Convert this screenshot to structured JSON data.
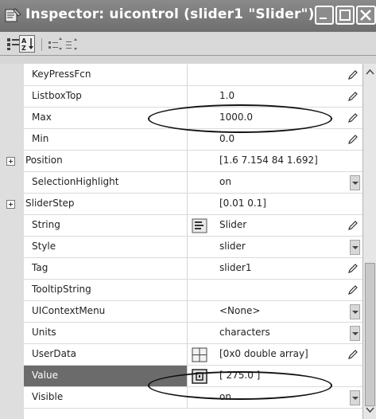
{
  "window": {
    "title": "Inspector:  uicontrol (slider1 \"Slider\")",
    "icon": "inspector-icon"
  },
  "toolbar": {
    "buttons": [
      "categorized-view-icon",
      "alphabetical-sort-icon",
      "expand-all-icon",
      "collapse-all-icon"
    ]
  },
  "properties": [
    {
      "name": "KeyPressFcn",
      "value": "",
      "editor": "pencil"
    },
    {
      "name": "ListboxTop",
      "value": "1.0",
      "editor": "pencil"
    },
    {
      "name": "Max",
      "value": "1000.0",
      "editor": "pencil"
    },
    {
      "name": "Min",
      "value": "0.0",
      "editor": "pencil"
    },
    {
      "name": "Position",
      "value": "[1.6 7.154 84 1.692]",
      "editor": "none",
      "expandable": true
    },
    {
      "name": "SelectionHighlight",
      "value": "on",
      "editor": "dropdown"
    },
    {
      "name": "SliderStep",
      "value": "[0.01 0.1]",
      "editor": "none",
      "expandable": true
    },
    {
      "name": "String",
      "value": "Slider",
      "editor": "pencil",
      "cell_icon": "text-editor-icon"
    },
    {
      "name": "Style",
      "value": "slider",
      "editor": "dropdown"
    },
    {
      "name": "Tag",
      "value": "slider1",
      "editor": "pencil"
    },
    {
      "name": "TooltipString",
      "value": "",
      "editor": "pencil"
    },
    {
      "name": "UIContextMenu",
      "value": "<None>",
      "editor": "dropdown"
    },
    {
      "name": "Units",
      "value": "characters",
      "editor": "dropdown"
    },
    {
      "name": "UserData",
      "value": "[0x0  double array]",
      "editor": "pencil",
      "cell_icon": "array-editor-icon"
    },
    {
      "name": "Value",
      "value": "[ 275.0 ]",
      "editor": "none",
      "cell_icon": "value-editor-icon",
      "selected": true
    },
    {
      "name": "Visible",
      "value": "on",
      "editor": "dropdown"
    }
  ],
  "colors": {
    "titlebar": "#7a7a7a",
    "selected_row": "#6b6b6b",
    "grid_background": "#ffffff"
  }
}
